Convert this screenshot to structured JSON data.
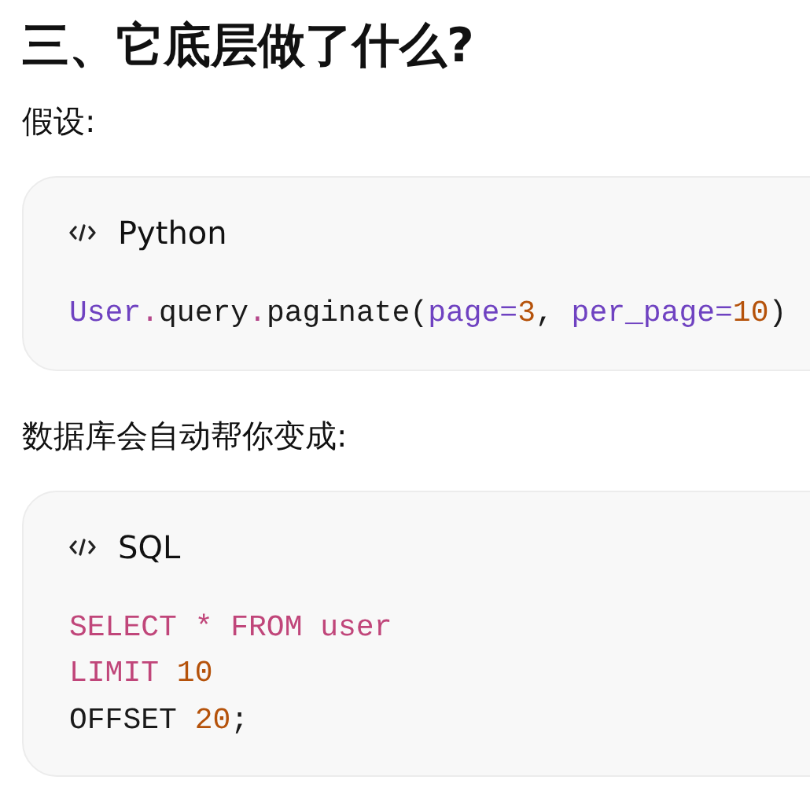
{
  "heading": "三、它底层做了什么?",
  "paragraphs": [
    "假设:",
    "数据库会自动帮你变成:"
  ],
  "code_blocks": [
    {
      "language": "Python",
      "lines": [
        [
          {
            "kind": "name",
            "text": "User"
          },
          {
            "kind": "operator",
            "text": "."
          },
          {
            "kind": "plain",
            "text": "query"
          },
          {
            "kind": "operator",
            "text": "."
          },
          {
            "kind": "plain",
            "text": "paginate("
          },
          {
            "kind": "name",
            "text": "page="
          },
          {
            "kind": "number",
            "text": "3"
          },
          {
            "kind": "plain",
            "text": ", "
          },
          {
            "kind": "name",
            "text": "per_page="
          },
          {
            "kind": "number",
            "text": "10"
          },
          {
            "kind": "plain",
            "text": ")"
          }
        ]
      ]
    },
    {
      "language": "SQL",
      "lines": [
        [
          {
            "kind": "keyword",
            "text": "SELECT * FROM user"
          }
        ],
        [
          {
            "kind": "keyword",
            "text": "LIMIT "
          },
          {
            "kind": "number",
            "text": "10"
          }
        ],
        [
          {
            "kind": "plain",
            "text": "OFFSET "
          },
          {
            "kind": "number",
            "text": "20"
          },
          {
            "kind": "plain",
            "text": ";"
          }
        ]
      ]
    }
  ]
}
